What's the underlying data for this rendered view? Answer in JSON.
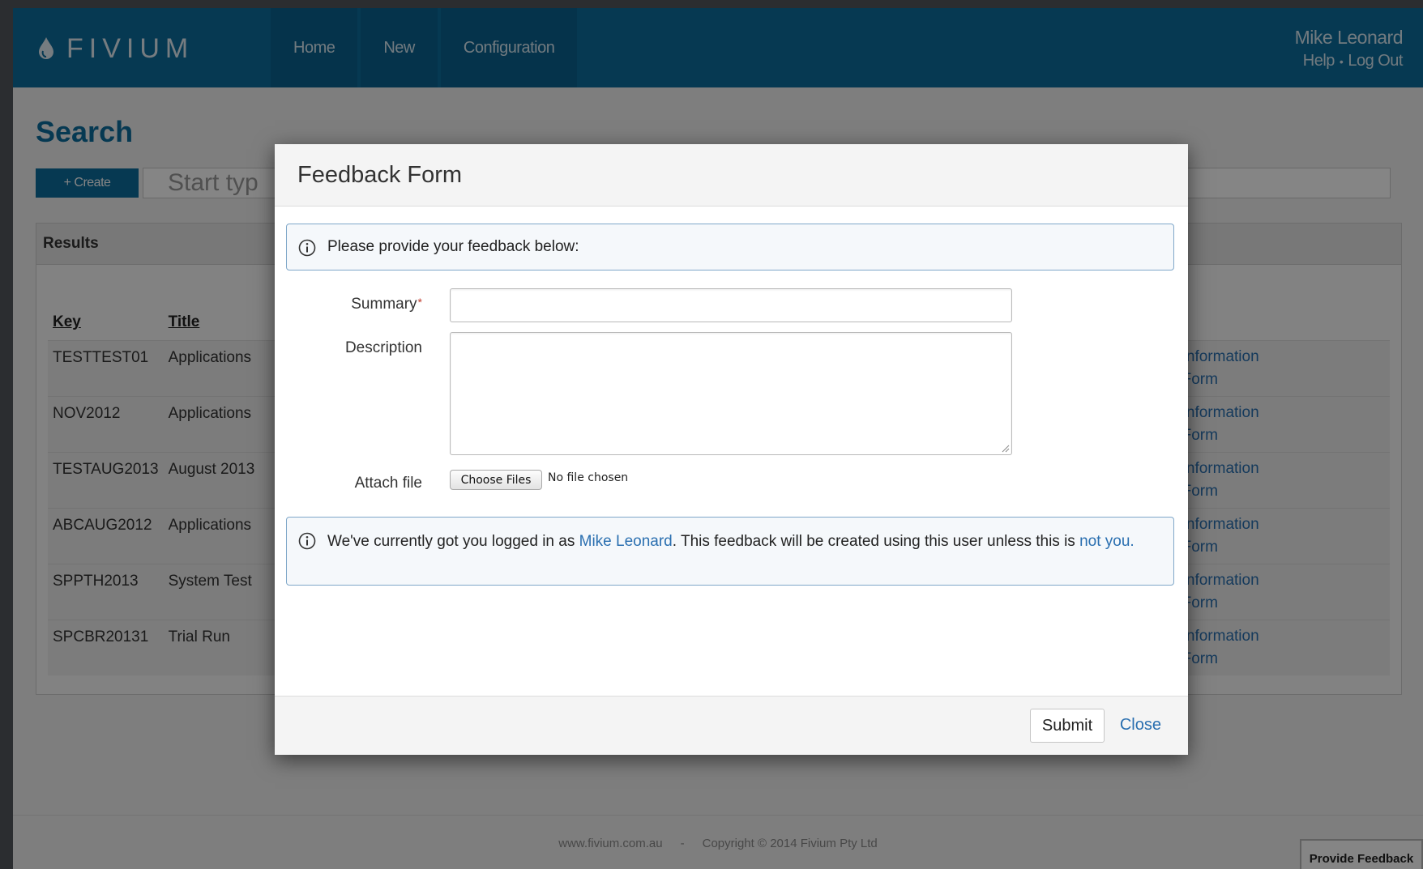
{
  "header": {
    "logo_text": "FIVIUM",
    "nav": [
      "Home",
      "New",
      "Configuration"
    ],
    "user_name": "Mike Leonard",
    "help_label": "Help",
    "logout_label": "Log Out",
    "brand_color": "#0d6d9e"
  },
  "page": {
    "title": "Search",
    "create_label": "+ Create",
    "search_placeholder": "Start typ",
    "results_heading": "Results",
    "columns": [
      "Key",
      "Title"
    ],
    "rows": [
      {
        "key": "TESTTEST01",
        "title": "Applications",
        "link1": "w Information",
        "link2": "w Form"
      },
      {
        "key": "NOV2012",
        "title": "Applications",
        "link1": "w Information",
        "link2": "w Form"
      },
      {
        "key": "TESTAUG2013",
        "title": "August 2013",
        "link1": "w Information",
        "link2": "w Form"
      },
      {
        "key": "ABCAUG2012",
        "title": "Applications",
        "link1": "w Information",
        "link2": "w Form"
      },
      {
        "key": "SPPTH2013",
        "title": "System Test",
        "link1": "w Information",
        "link2": "w Form"
      },
      {
        "key": "SPCBR20131",
        "title": "Trial Run",
        "link1": "w Information",
        "link2": "w Form"
      }
    ]
  },
  "footer": {
    "site": "www.fivium.com.au",
    "separator": "-",
    "copyright": "Copyright © 2014 Fivium Pty Ltd",
    "feedback_tab": "Provide Feedback"
  },
  "modal": {
    "title": "Feedback Form",
    "intro": "Please provide your feedback below:",
    "summary_label": "Summary",
    "required_mark": "*",
    "description_label": "Description",
    "attach_label": "Attach file",
    "choose_files": "Choose Files",
    "file_status": "No file chosen",
    "notice_prefix": "We've currently got you logged in as ",
    "notice_user": "Mike Leonard",
    "notice_middle": ". This feedback will be created using this user unless this is ",
    "notice_link": "not you",
    "notice_suffix": ".",
    "submit_label": "Submit",
    "close_label": "Close",
    "icons": [
      "info-icon"
    ]
  }
}
